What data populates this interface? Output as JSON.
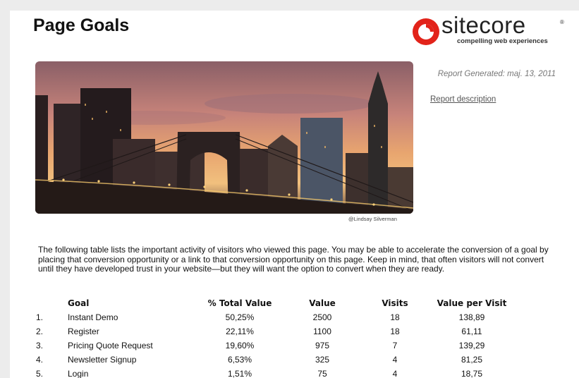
{
  "page": {
    "title": "Page Goals",
    "report_generated": "Report Generated: maj. 13, 2011",
    "report_description_link": "Report description",
    "photo_credit": "@Lindsay Silverman",
    "intro_text": "The following table lists the important activity of visitors who viewed this page. You may be able to accelerate the conversion of a goal by placing that conversion opportunity or a link to that conversion opportunity on this page. Keep in mind, that often visitors will not convert until they have developed trust in your website—but they will want the option to convert when they are ready."
  },
  "logo": {
    "word": "sitecore",
    "registered": "®",
    "tagline": "compelling web experiences",
    "brand_color": "#e2231a"
  },
  "table": {
    "headers": [
      "",
      "Goal",
      "% Total Value",
      "Value",
      "Visits",
      "Value per Visit"
    ],
    "rows": [
      {
        "num": "1.",
        "goal": "Instant Demo",
        "pct": "50,25%",
        "value": "2500",
        "visits": "18",
        "vpv": "138,89"
      },
      {
        "num": "2.",
        "goal": "Register",
        "pct": "22,11%",
        "value": "1100",
        "visits": "18",
        "vpv": "61,11"
      },
      {
        "num": "3.",
        "goal": "Pricing Quote Request",
        "pct": "19,60%",
        "value": "975",
        "visits": "7",
        "vpv": "139,29"
      },
      {
        "num": "4.",
        "goal": "Newsletter Signup",
        "pct": "6,53%",
        "value": "325",
        "visits": "4",
        "vpv": "81,25"
      },
      {
        "num": "5.",
        "goal": "Login",
        "pct": "1,51%",
        "value": "75",
        "visits": "4",
        "vpv": "18,75"
      }
    ]
  }
}
